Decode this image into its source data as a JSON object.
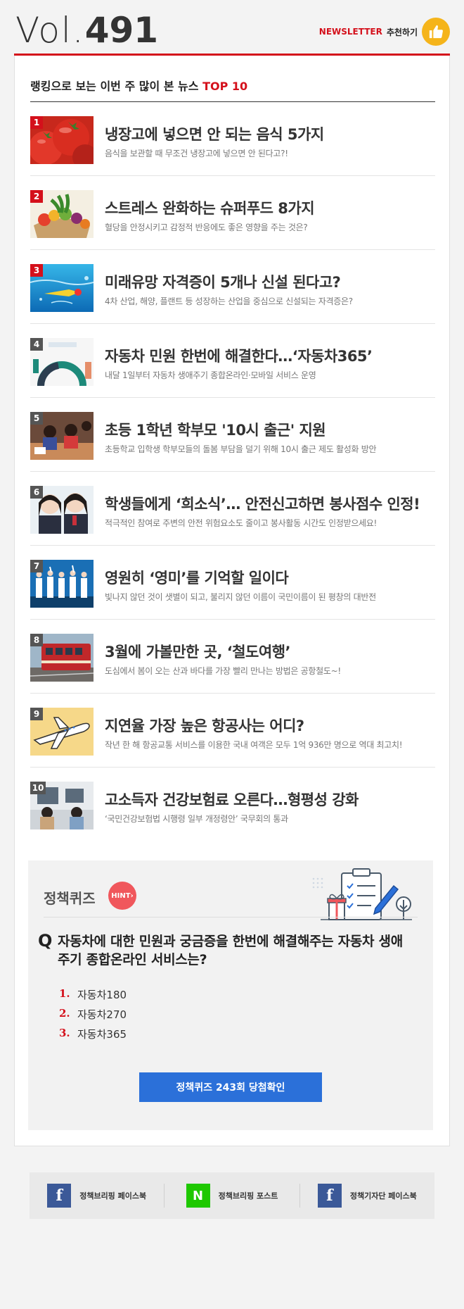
{
  "header": {
    "vol_prefix": "Vol.",
    "vol_number": "491",
    "newsletter_en": "NEWSLETTER",
    "newsletter_ko": "추천하기",
    "thumb_icon": "thumbs-up-icon"
  },
  "ranking": {
    "title_ko": "랭킹으로 보는 이번 주 많이 본 뉴스 ",
    "title_top": "TOP 10",
    "items": [
      {
        "rank": "1",
        "title": "냉장고에 넣으면 안 되는 음식 5가지",
        "desc": "음식을 보관할 때 무조건 냉장고에 넣으면 안 된다고?!",
        "badge_color": "#d4101b"
      },
      {
        "rank": "2",
        "title": "스트레스 완화하는 슈퍼푸드 8가지",
        "desc": "혈당을 안정시키고 감정적 반응에도 좋은 영향을 주는 것은?",
        "badge_color": "#d4101b"
      },
      {
        "rank": "3",
        "title": "미래유망 자격증이 5개나 신설 된다고?",
        "desc": "4차 산업, 해양, 플랜트 등 성장하는 산업을 중심으로 신설되는 자격증은?",
        "badge_color": "#d4101b"
      },
      {
        "rank": "4",
        "title": "자동차 민원 한번에 해결한다…‘자동차365’",
        "desc": "내달 1일부터 자동차 생애주기 종합온라인·모바일 서비스 운영",
        "badge_color": "#555555"
      },
      {
        "rank": "5",
        "title": "초등 1학년 학부모 '10시 출근' 지원",
        "desc": "초등학교 입학생 학부모들의 돌봄 부담을 덜기 위해 10시 출근 제도 활성화 방안",
        "badge_color": "#555555"
      },
      {
        "rank": "6",
        "title": "학생들에게 ‘희소식’…  안전신고하면 봉사점수 인정!",
        "desc": "적극적인 참여로 주변의 안전 위험요소도 줄이고 봉사활동 시간도 인정받으세요!",
        "badge_color": "#555555"
      },
      {
        "rank": "7",
        "title": "영원히 ‘영미’를 기억할 일이다",
        "desc": "빛나지 않던 것이 샛별이 되고, 불리지 않던 이름이 국민이름이 된 평창의 대반전",
        "badge_color": "#555555"
      },
      {
        "rank": "8",
        "title": "3월에 가볼만한 곳, ‘철도여행’",
        "desc": "도심에서 봄이 오는 산과 바다를 가장 빨리 만나는 방법은 공항철도~!",
        "badge_color": "#555555"
      },
      {
        "rank": "9",
        "title": "지연율 가장 높은 항공사는 어디?",
        "desc": "작년 한 해 항공교통 서비스를 이용한 국내 여객은 모두 1억 936만 명으로 역대 최고치!",
        "badge_color": "#555555"
      },
      {
        "rank": "10",
        "title": "고소득자 건강보험료 오른다…형평성 강화",
        "desc": "‘국민건강보험법 시행령 일부 개정령안’ 국무회의 통과",
        "badge_color": "#555555"
      }
    ]
  },
  "quiz": {
    "title": "정책퀴즈",
    "hint": "HINT",
    "q_mark": "Q",
    "question": "자동차에 대한 민원과 궁금증을 한번에 해결해주는 자동차 생애주기 종합온라인 서비스는?",
    "options": [
      {
        "n": "1.",
        "text": "자동차180"
      },
      {
        "n": "2.",
        "text": "자동차270"
      },
      {
        "n": "3.",
        "text": "자동차365"
      }
    ],
    "button": "정책퀴즈 243회 당첨확인"
  },
  "footer": {
    "items": [
      {
        "icon": "facebook-icon",
        "glyph": "f",
        "color": "#3b5998",
        "label": "정책브리핑 페이스북"
      },
      {
        "icon": "naver-post-icon",
        "glyph": "N",
        "color": "#1ec800",
        "label": "정책브리핑 포스트"
      },
      {
        "icon": "facebook-icon",
        "glyph": "f",
        "color": "#3b5998",
        "label": "정책기자단 페이스북"
      }
    ]
  },
  "colors": {
    "accent_red": "#d4101b",
    "button_blue": "#2b70d9",
    "hint_red": "#f0575c"
  }
}
